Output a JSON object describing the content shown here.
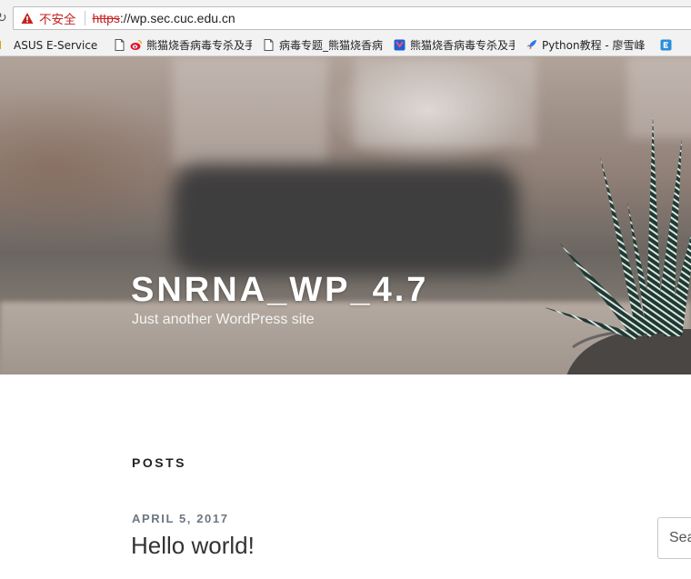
{
  "browser": {
    "address_bar": {
      "security_label": "不安全",
      "scheme": "https",
      "separator": "://",
      "host": "wp.sec.cuc.edu.cn"
    },
    "bookmarks": [
      {
        "label": "ASUS E-Service",
        "icon": "asus-icon"
      },
      {
        "label": "熊猫烧香病毒专杀及手",
        "icon": "weibo-icon"
      },
      {
        "label": "病毒专题_熊猫烧香病毒",
        "icon": "page-icon"
      },
      {
        "label": "熊猫烧香病毒专杀及手",
        "icon": "bookmark-blue-icon"
      },
      {
        "label": "Python教程 - 廖雪峰",
        "icon": "rocket-icon"
      },
      {
        "label": "",
        "icon": "e-icon"
      }
    ]
  },
  "site": {
    "title": "SNRNA_WP_4.7",
    "tagline": "Just another WordPress site"
  },
  "content": {
    "section_title": "POSTS",
    "posts": [
      {
        "date": "APRIL 5, 2017",
        "title": "Hello world!"
      }
    ]
  },
  "sidebar": {
    "search_placeholder": "Search …"
  },
  "colors": {
    "insecure_red": "#c5221f",
    "date_gray": "#6c7781",
    "heading_dark": "#222222"
  }
}
